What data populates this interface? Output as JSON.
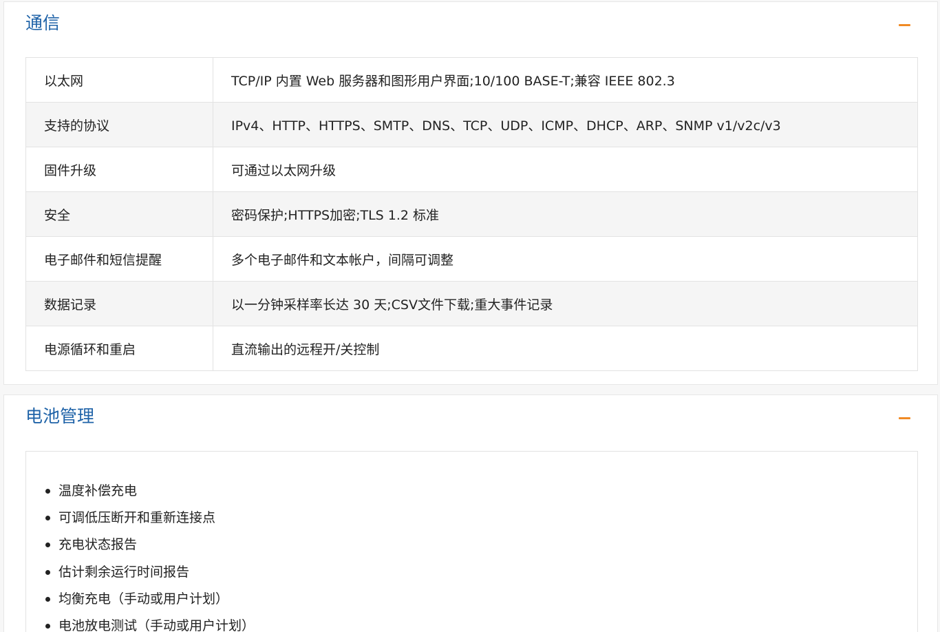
{
  "sections": {
    "communication": {
      "title": "通信",
      "rows": [
        {
          "label": "以太网",
          "value": "TCP/IP 内置 Web 服务器和图形用户界面;10/100 BASE-T;兼容 IEEE 802.3"
        },
        {
          "label": "支持的协议",
          "value": "IPv4、HTTP、HTTPS、SMTP、DNS、TCP、UDP、ICMP、DHCP、ARP、SNMP v1/v2c/v3"
        },
        {
          "label": "固件升级",
          "value": "可通过以太网升级"
        },
        {
          "label": "安全",
          "value": "密码保护;HTTPS加密;TLS 1.2 标准"
        },
        {
          "label": "电子邮件和短信提醒",
          "value": "多个电子邮件和文本帐户，间隔可调整"
        },
        {
          "label": "数据记录",
          "value": "以一分钟采样率长达 30 天;CSV文件下载;重大事件记录"
        },
        {
          "label": "电源循环和重启",
          "value": "直流输出的远程开/关控制"
        }
      ]
    },
    "battery": {
      "title": "电池管理",
      "items": [
        "温度补偿充电",
        "可调低压断开和重新连接点",
        "充电状态报告",
        "估计剩余运行时间报告",
        "均衡充电（手动或用户计划）",
        "电池放电测试（手动或用户计划）"
      ]
    }
  },
  "icons": {
    "collapse": "minus-icon"
  },
  "colors": {
    "title": "#1f63a8",
    "accent": "#f08a24",
    "row_alt": "#f5f5f5",
    "border": "#e2e2e2"
  }
}
